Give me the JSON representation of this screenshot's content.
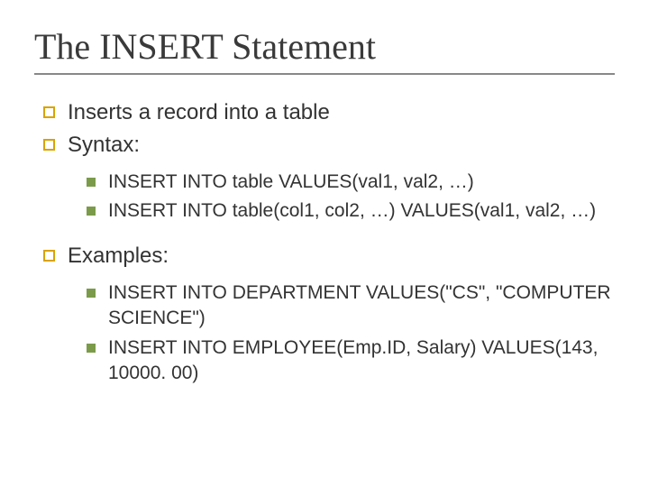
{
  "title": "The INSERT Statement",
  "items": [
    {
      "text": "Inserts a record into a table"
    },
    {
      "text": "Syntax:"
    }
  ],
  "syntax": [
    {
      "text": "INSERT INTO table VALUES(val1, val2, …)"
    },
    {
      "text": "INSERT INTO table(col1, col2, …) VALUES(val1, val2, …)"
    }
  ],
  "examples_label": "Examples:",
  "examples": [
    {
      "text": "INSERT INTO DEPARTMENT VALUES(\"CS\", \"COMPUTER SCIENCE\")"
    },
    {
      "text": "INSERT INTO EMPLOYEE(Emp.ID, Salary) VALUES(143, 10000. 00)"
    }
  ]
}
